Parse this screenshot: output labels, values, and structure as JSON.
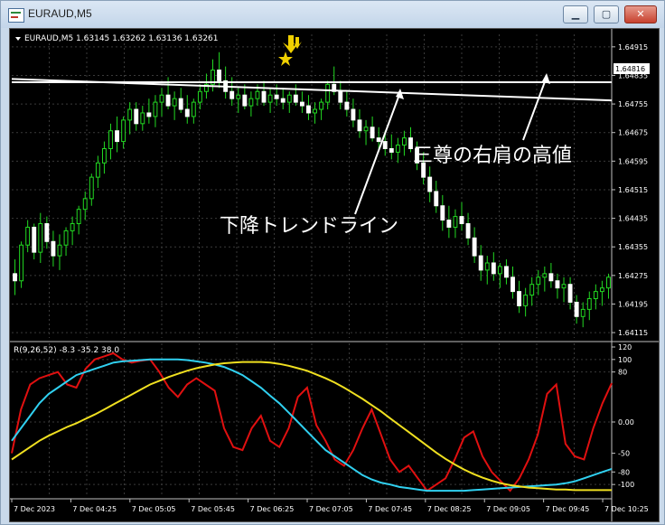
{
  "window": {
    "title": "EURAUD,M5",
    "minimize_label": "▁",
    "maximize_label": "▢",
    "close_label": "✕"
  },
  "chart_data": [
    {
      "type": "candlestick",
      "symbol_header": "EURAUD,M5  1.63145 1.63262 1.63136 1.63261",
      "y_ticks": [
        "1.64915",
        "1.64835",
        "1.64755",
        "1.64675",
        "1.64595",
        "1.64515",
        "1.64435",
        "1.64355",
        "1.64275",
        "1.64195",
        "1.64115"
      ],
      "ylim": [
        1.641,
        1.6495
      ],
      "current_price_label": "1.64816",
      "shoulder_level": 1.64816,
      "trendline": {
        "from": [
          0,
          1.64825
        ],
        "to": [
          100,
          1.64765
        ]
      },
      "annotations": {
        "left": "下降トレンドライン",
        "right": "三尊の右肩の高値"
      },
      "candles_ohlc": [
        [
          1.6428,
          1.6432,
          1.6422,
          1.6426
        ],
        [
          1.6426,
          1.6437,
          1.6424,
          1.6436
        ],
        [
          1.6436,
          1.6443,
          1.6434,
          1.6441
        ],
        [
          1.6441,
          1.6442,
          1.6432,
          1.6434
        ],
        [
          1.6434,
          1.6445,
          1.6431,
          1.6442
        ],
        [
          1.6442,
          1.6444,
          1.6435,
          1.6437
        ],
        [
          1.6437,
          1.644,
          1.643,
          1.6433
        ],
        [
          1.6433,
          1.6439,
          1.6429,
          1.6436
        ],
        [
          1.6436,
          1.6441,
          1.6433,
          1.644
        ],
        [
          1.644,
          1.6444,
          1.6436,
          1.6442
        ],
        [
          1.6442,
          1.6447,
          1.6439,
          1.6446
        ],
        [
          1.6446,
          1.6451,
          1.6443,
          1.6449
        ],
        [
          1.6449,
          1.6456,
          1.6447,
          1.6455
        ],
        [
          1.6455,
          1.6461,
          1.6452,
          1.6459
        ],
        [
          1.6459,
          1.6465,
          1.6456,
          1.6463
        ],
        [
          1.6463,
          1.647,
          1.646,
          1.6468
        ],
        [
          1.6468,
          1.6472,
          1.6462,
          1.6465
        ],
        [
          1.6465,
          1.6472,
          1.6463,
          1.6471
        ],
        [
          1.6471,
          1.6476,
          1.6467,
          1.6474
        ],
        [
          1.6474,
          1.6476,
          1.6468,
          1.647
        ],
        [
          1.647,
          1.6475,
          1.6468,
          1.6473
        ],
        [
          1.6473,
          1.6477,
          1.647,
          1.6472
        ],
        [
          1.6472,
          1.6478,
          1.6469,
          1.6476
        ],
        [
          1.6476,
          1.648,
          1.6472,
          1.6478
        ],
        [
          1.6478,
          1.6483,
          1.6474,
          1.6475
        ],
        [
          1.6475,
          1.6479,
          1.6471,
          1.6477
        ],
        [
          1.6477,
          1.648,
          1.6473,
          1.6474
        ],
        [
          1.6474,
          1.6478,
          1.647,
          1.6472
        ],
        [
          1.6472,
          1.6477,
          1.647,
          1.6476
        ],
        [
          1.6476,
          1.6481,
          1.6474,
          1.6479
        ],
        [
          1.6479,
          1.6484,
          1.6477,
          1.6481
        ],
        [
          1.6481,
          1.6488,
          1.6479,
          1.6485
        ],
        [
          1.6485,
          1.649,
          1.648,
          1.6482
        ],
        [
          1.6482,
          1.6486,
          1.6477,
          1.6479
        ],
        [
          1.6479,
          1.6483,
          1.6475,
          1.6477
        ],
        [
          1.6477,
          1.648,
          1.6473,
          1.6478
        ],
        [
          1.6478,
          1.6481,
          1.6474,
          1.6475
        ],
        [
          1.6475,
          1.6479,
          1.6472,
          1.6477
        ],
        [
          1.6477,
          1.6481,
          1.6475,
          1.6479
        ],
        [
          1.6479,
          1.6482,
          1.6475,
          1.6476
        ],
        [
          1.6476,
          1.648,
          1.6473,
          1.6478
        ],
        [
          1.6478,
          1.6481,
          1.6475,
          1.6477
        ],
        [
          1.6477,
          1.648,
          1.6474,
          1.6476
        ],
        [
          1.6476,
          1.6479,
          1.6473,
          1.6478
        ],
        [
          1.6478,
          1.6481,
          1.6475,
          1.6476
        ],
        [
          1.6476,
          1.6479,
          1.6473,
          1.6475
        ],
        [
          1.6475,
          1.6478,
          1.6471,
          1.6473
        ],
        [
          1.6473,
          1.6476,
          1.647,
          1.6474
        ],
        [
          1.6474,
          1.6477,
          1.6471,
          1.6476
        ],
        [
          1.6476,
          1.6482,
          1.6474,
          1.6481
        ],
        [
          1.6481,
          1.6486,
          1.6478,
          1.6479
        ],
        [
          1.6479,
          1.6482,
          1.6474,
          1.6476
        ],
        [
          1.6476,
          1.6479,
          1.6472,
          1.6474
        ],
        [
          1.6474,
          1.6477,
          1.6469,
          1.6471
        ],
        [
          1.6471,
          1.6474,
          1.6466,
          1.6468
        ],
        [
          1.6468,
          1.6471,
          1.6464,
          1.6469
        ],
        [
          1.6469,
          1.6472,
          1.6465,
          1.6466
        ],
        [
          1.6466,
          1.6469,
          1.6462,
          1.6465
        ],
        [
          1.6465,
          1.6468,
          1.6461,
          1.6463
        ],
        [
          1.6463,
          1.6467,
          1.646,
          1.6462
        ],
        [
          1.6462,
          1.6466,
          1.6459,
          1.6464
        ],
        [
          1.6464,
          1.6468,
          1.6461,
          1.6466
        ],
        [
          1.6466,
          1.6469,
          1.6462,
          1.6463
        ],
        [
          1.6463,
          1.6465,
          1.6457,
          1.6459
        ],
        [
          1.6459,
          1.6462,
          1.6453,
          1.6455
        ],
        [
          1.6455,
          1.6458,
          1.6448,
          1.6451
        ],
        [
          1.6451,
          1.6454,
          1.6445,
          1.6447
        ],
        [
          1.6447,
          1.645,
          1.644,
          1.6443
        ],
        [
          1.6443,
          1.6447,
          1.6438,
          1.6441
        ],
        [
          1.6441,
          1.6446,
          1.6438,
          1.6444
        ],
        [
          1.6444,
          1.6448,
          1.644,
          1.6442
        ],
        [
          1.6442,
          1.6445,
          1.6436,
          1.6438
        ],
        [
          1.6438,
          1.6441,
          1.6431,
          1.6433
        ],
        [
          1.6433,
          1.6436,
          1.6426,
          1.6429
        ],
        [
          1.6429,
          1.6433,
          1.6425,
          1.6431
        ],
        [
          1.6431,
          1.6434,
          1.6426,
          1.6428
        ],
        [
          1.6428,
          1.6431,
          1.6424,
          1.643
        ],
        [
          1.643,
          1.6432,
          1.6425,
          1.6427
        ],
        [
          1.6427,
          1.643,
          1.6421,
          1.6423
        ],
        [
          1.6423,
          1.6426,
          1.6417,
          1.6419
        ],
        [
          1.6419,
          1.6424,
          1.6416,
          1.6422
        ],
        [
          1.6422,
          1.6427,
          1.6419,
          1.6425
        ],
        [
          1.6425,
          1.6429,
          1.6422,
          1.6427
        ],
        [
          1.6427,
          1.643,
          1.6423,
          1.6428
        ],
        [
          1.6428,
          1.6431,
          1.6424,
          1.6426
        ],
        [
          1.6426,
          1.6428,
          1.6421,
          1.6424
        ],
        [
          1.6424,
          1.6427,
          1.642,
          1.6425
        ],
        [
          1.6425,
          1.6427,
          1.6418,
          1.642
        ],
        [
          1.642,
          1.6422,
          1.6414,
          1.6416
        ],
        [
          1.6416,
          1.642,
          1.6413,
          1.6418
        ],
        [
          1.6418,
          1.6423,
          1.6415,
          1.6421
        ],
        [
          1.6421,
          1.6425,
          1.6418,
          1.6423
        ],
        [
          1.6423,
          1.6426,
          1.6419,
          1.6424
        ],
        [
          1.6424,
          1.6428,
          1.6421,
          1.6427
        ]
      ]
    },
    {
      "type": "line",
      "header": "R(9,26,52) -8.3 -35.2 38.0",
      "y_ticks": [
        "120",
        "100",
        "80",
        "0.00",
        "-50",
        "-80",
        "-100"
      ],
      "ylim": [
        -120,
        120
      ],
      "x_tick_labels": [
        "7 Dec 2023",
        "7 Dec 04:25",
        "7 Dec 05:05",
        "7 Dec 05:45",
        "7 Dec 06:25",
        "7 Dec 07:05",
        "7 Dec 07:45",
        "7 Dec 08:25",
        "7 Dec 09:05",
        "7 Dec 09:45",
        "7 Dec 10:25"
      ],
      "series": [
        {
          "color": "#e01010",
          "values": [
            -50,
            20,
            60,
            70,
            75,
            80,
            60,
            55,
            85,
            100,
            105,
            110,
            100,
            95,
            98,
            100,
            80,
            55,
            40,
            60,
            70,
            60,
            50,
            -10,
            -40,
            -45,
            -10,
            10,
            -30,
            -40,
            -10,
            40,
            55,
            -5,
            -30,
            -60,
            -70,
            -45,
            -10,
            20,
            -20,
            -60,
            -80,
            -70,
            -90,
            -110,
            -100,
            -90,
            -60,
            -25,
            -15,
            -55,
            -80,
            -95,
            -110,
            -90,
            -60,
            -20,
            45,
            60,
            -35,
            -55,
            -60,
            -10,
            30,
            62
          ]
        },
        {
          "color": "#30d0f0",
          "values": [
            -30,
            -10,
            10,
            30,
            45,
            55,
            65,
            75,
            80,
            85,
            90,
            95,
            97,
            98,
            99,
            100,
            100,
            100,
            100,
            99,
            97,
            95,
            92,
            88,
            82,
            75,
            65,
            55,
            42,
            30,
            15,
            0,
            -15,
            -30,
            -45,
            -55,
            -65,
            -75,
            -85,
            -92,
            -97,
            -100,
            -104,
            -106,
            -108,
            -110,
            -110,
            -110,
            -110,
            -110,
            -109,
            -108,
            -107,
            -106,
            -105,
            -104,
            -103,
            -102,
            -101,
            -100,
            -98,
            -95,
            -90,
            -85,
            -80,
            -75
          ]
        },
        {
          "color": "#f0e020",
          "values": [
            -60,
            -50,
            -40,
            -30,
            -22,
            -15,
            -8,
            -2,
            5,
            12,
            20,
            28,
            36,
            44,
            52,
            60,
            66,
            72,
            77,
            82,
            86,
            89,
            92,
            94,
            95,
            96,
            96,
            96,
            95,
            93,
            90,
            86,
            82,
            76,
            70,
            63,
            55,
            46,
            37,
            27,
            17,
            6,
            -5,
            -16,
            -27,
            -38,
            -49,
            -59,
            -68,
            -76,
            -83,
            -89,
            -94,
            -98,
            -101,
            -103,
            -105,
            -106,
            -107,
            -108,
            -108,
            -109,
            -109,
            -109,
            -109,
            -109
          ]
        }
      ]
    }
  ]
}
